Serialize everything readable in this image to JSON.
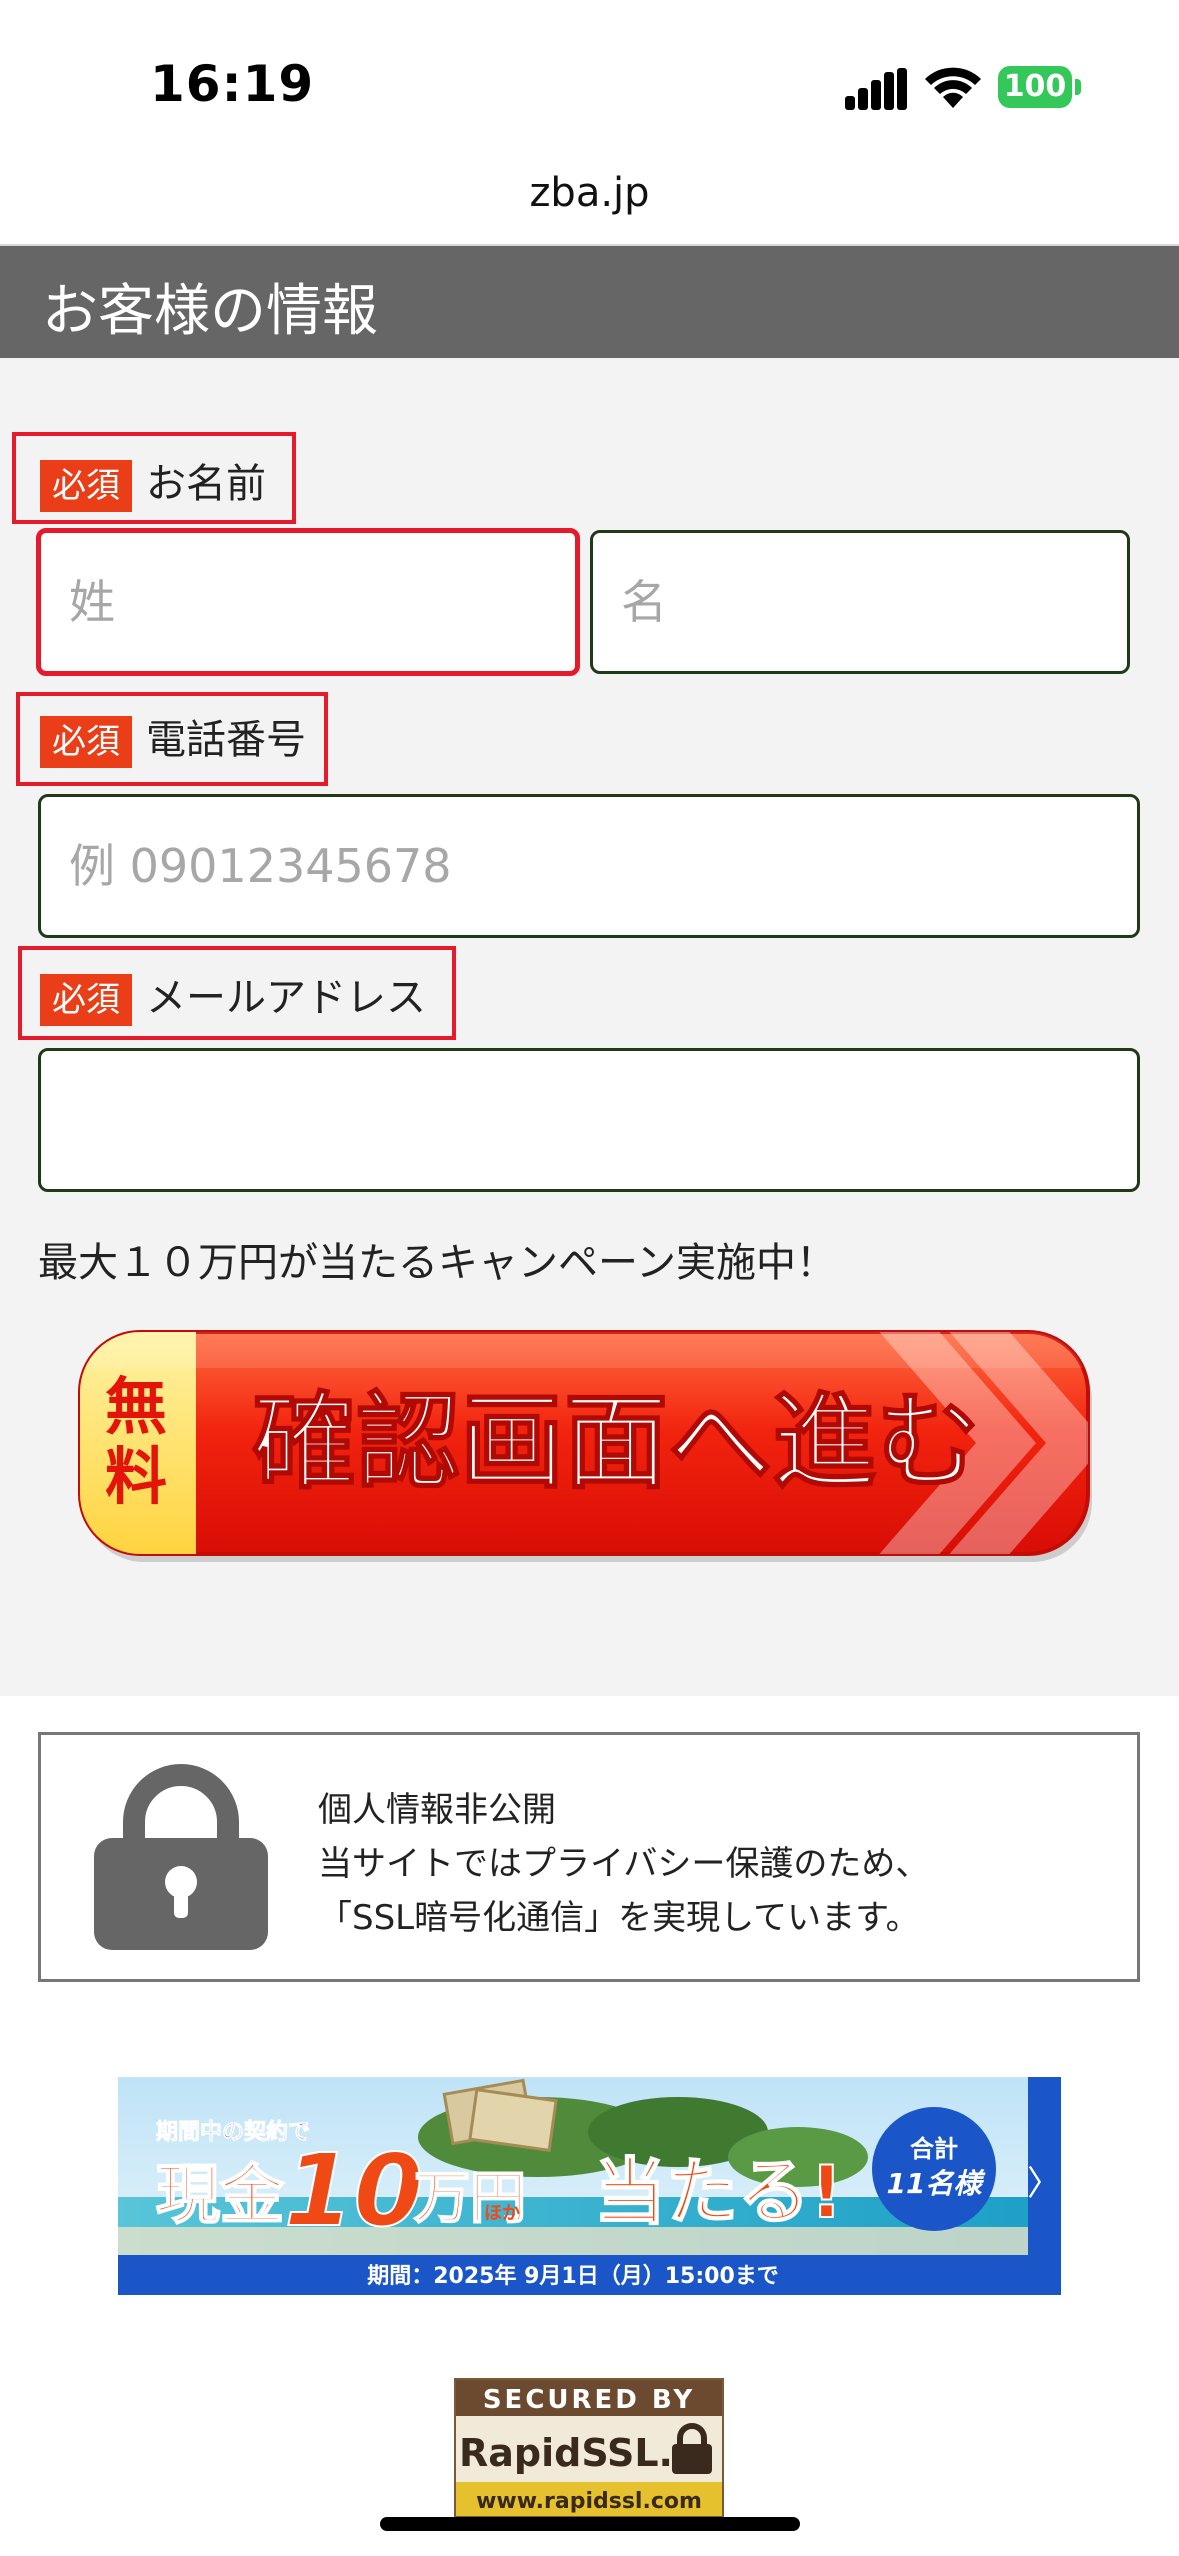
{
  "status_bar": {
    "time": "16:19",
    "battery": "100"
  },
  "browser": {
    "url": "zba.jp"
  },
  "header": {
    "title": "お客様の情報"
  },
  "form": {
    "required_badge": "必須",
    "name_label": "お名前",
    "last_name_placeholder": "姓",
    "first_name_placeholder": "名",
    "phone_label": "電話番号",
    "phone_placeholder": "例 09012345678",
    "email_label": "メールアドレス",
    "email_placeholder": "",
    "campaign_text": "最大１０万円が当たるキャンペーン実施中！"
  },
  "cta": {
    "free_badge_line1": "無",
    "free_badge_line2": "料",
    "label": "確認画面へ進む"
  },
  "security": {
    "line1": "個人情報非公開",
    "line2": "当サイトではプライバシー保護のため、",
    "line3": "「SSL暗号化通信」を実現しています。",
    "icon": "lock-icon"
  },
  "banner": {
    "top_text": "期間中の契約で",
    "main_text_1": "現金",
    "main_amount": "10",
    "main_text_2": "万円",
    "main_hoka": "ほか",
    "main_text_3": "当たる!",
    "badge_line1": "合計",
    "badge_line2": "11名様",
    "period": "期間：2025年 9月1日（月）15:00まで",
    "arrow": "〉"
  },
  "ssl_seal": {
    "line1": "SECURED BY",
    "line2": "RapidSSL.",
    "line3": "www.rapidssl.com"
  },
  "colors": {
    "header_bg": "#666666",
    "required_red": "#ea3e19",
    "cta_red": "#e8150b",
    "field_border": "#1f3a17"
  }
}
